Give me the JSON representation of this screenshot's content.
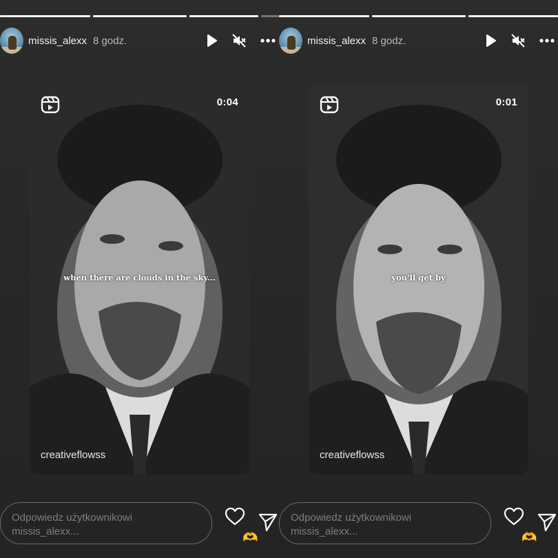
{
  "stories": [
    {
      "username": "missis_alexx",
      "time_ago": "8 godz.",
      "video": {
        "duration": "0:04",
        "caption": "when there are clouds in the sky...",
        "credit": "creativeflowss"
      },
      "reply_placeholder": "Odpowiedz użytkownikowi missis_alexx...",
      "reaction_emoji": "🫶"
    },
    {
      "username": "missis_alexx",
      "time_ago": "8 godz.",
      "video": {
        "duration": "0:01",
        "caption": "you'll get by",
        "credit": "creativeflowss"
      },
      "reply_placeholder": "Odpowiedz użytkownikowi missis_alexx...",
      "reaction_emoji": "🫶"
    }
  ],
  "icons": [
    "play-icon",
    "mute-icon",
    "more-icon",
    "reels-icon",
    "heart-icon",
    "send-icon"
  ],
  "colors": {
    "background": "#2a2a2a",
    "text": "#ffffff",
    "muted_text": "#b9b9b9",
    "reply_border": "#6a6a6a"
  }
}
